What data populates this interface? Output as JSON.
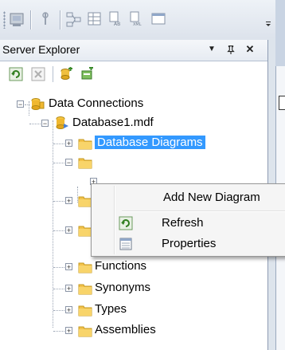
{
  "panel": {
    "title": "Server Explorer",
    "pin_glyph": "▼",
    "dock_glyph": "ᵃ",
    "close_glyph": "✕"
  },
  "toolbar_icons": [
    "server-explorer-icon",
    "property-icon",
    "class-diagram-icon",
    "grid-icon",
    "xml-icon",
    "xml-schema-icon",
    "window-icon"
  ],
  "pane_toolbar_icons": [
    "refresh-icon",
    "stop-icon",
    "connect-to-database-icon",
    "connect-to-server-icon"
  ],
  "tree": {
    "root": "Data Connections",
    "database": "Database1.mdf",
    "items": [
      {
        "label": "Database Diagrams",
        "selected": true
      },
      {
        "label": ""
      },
      {
        "label": ""
      },
      {
        "label": ""
      },
      {
        "label": ""
      },
      {
        "label": "Functions"
      },
      {
        "label": "Synonyms"
      },
      {
        "label": "Types"
      },
      {
        "label": "Assemblies"
      }
    ]
  },
  "context_menu": {
    "items": [
      {
        "label": "Add New Diagram",
        "icon": ""
      },
      {
        "label": "Refresh",
        "icon": "refresh-icon"
      },
      {
        "label": "Properties",
        "icon": "properties-icon"
      }
    ]
  },
  "colors": {
    "selection": "#3399ff",
    "folder": "#f3c24a",
    "title_bar": "#e6ebf2"
  }
}
